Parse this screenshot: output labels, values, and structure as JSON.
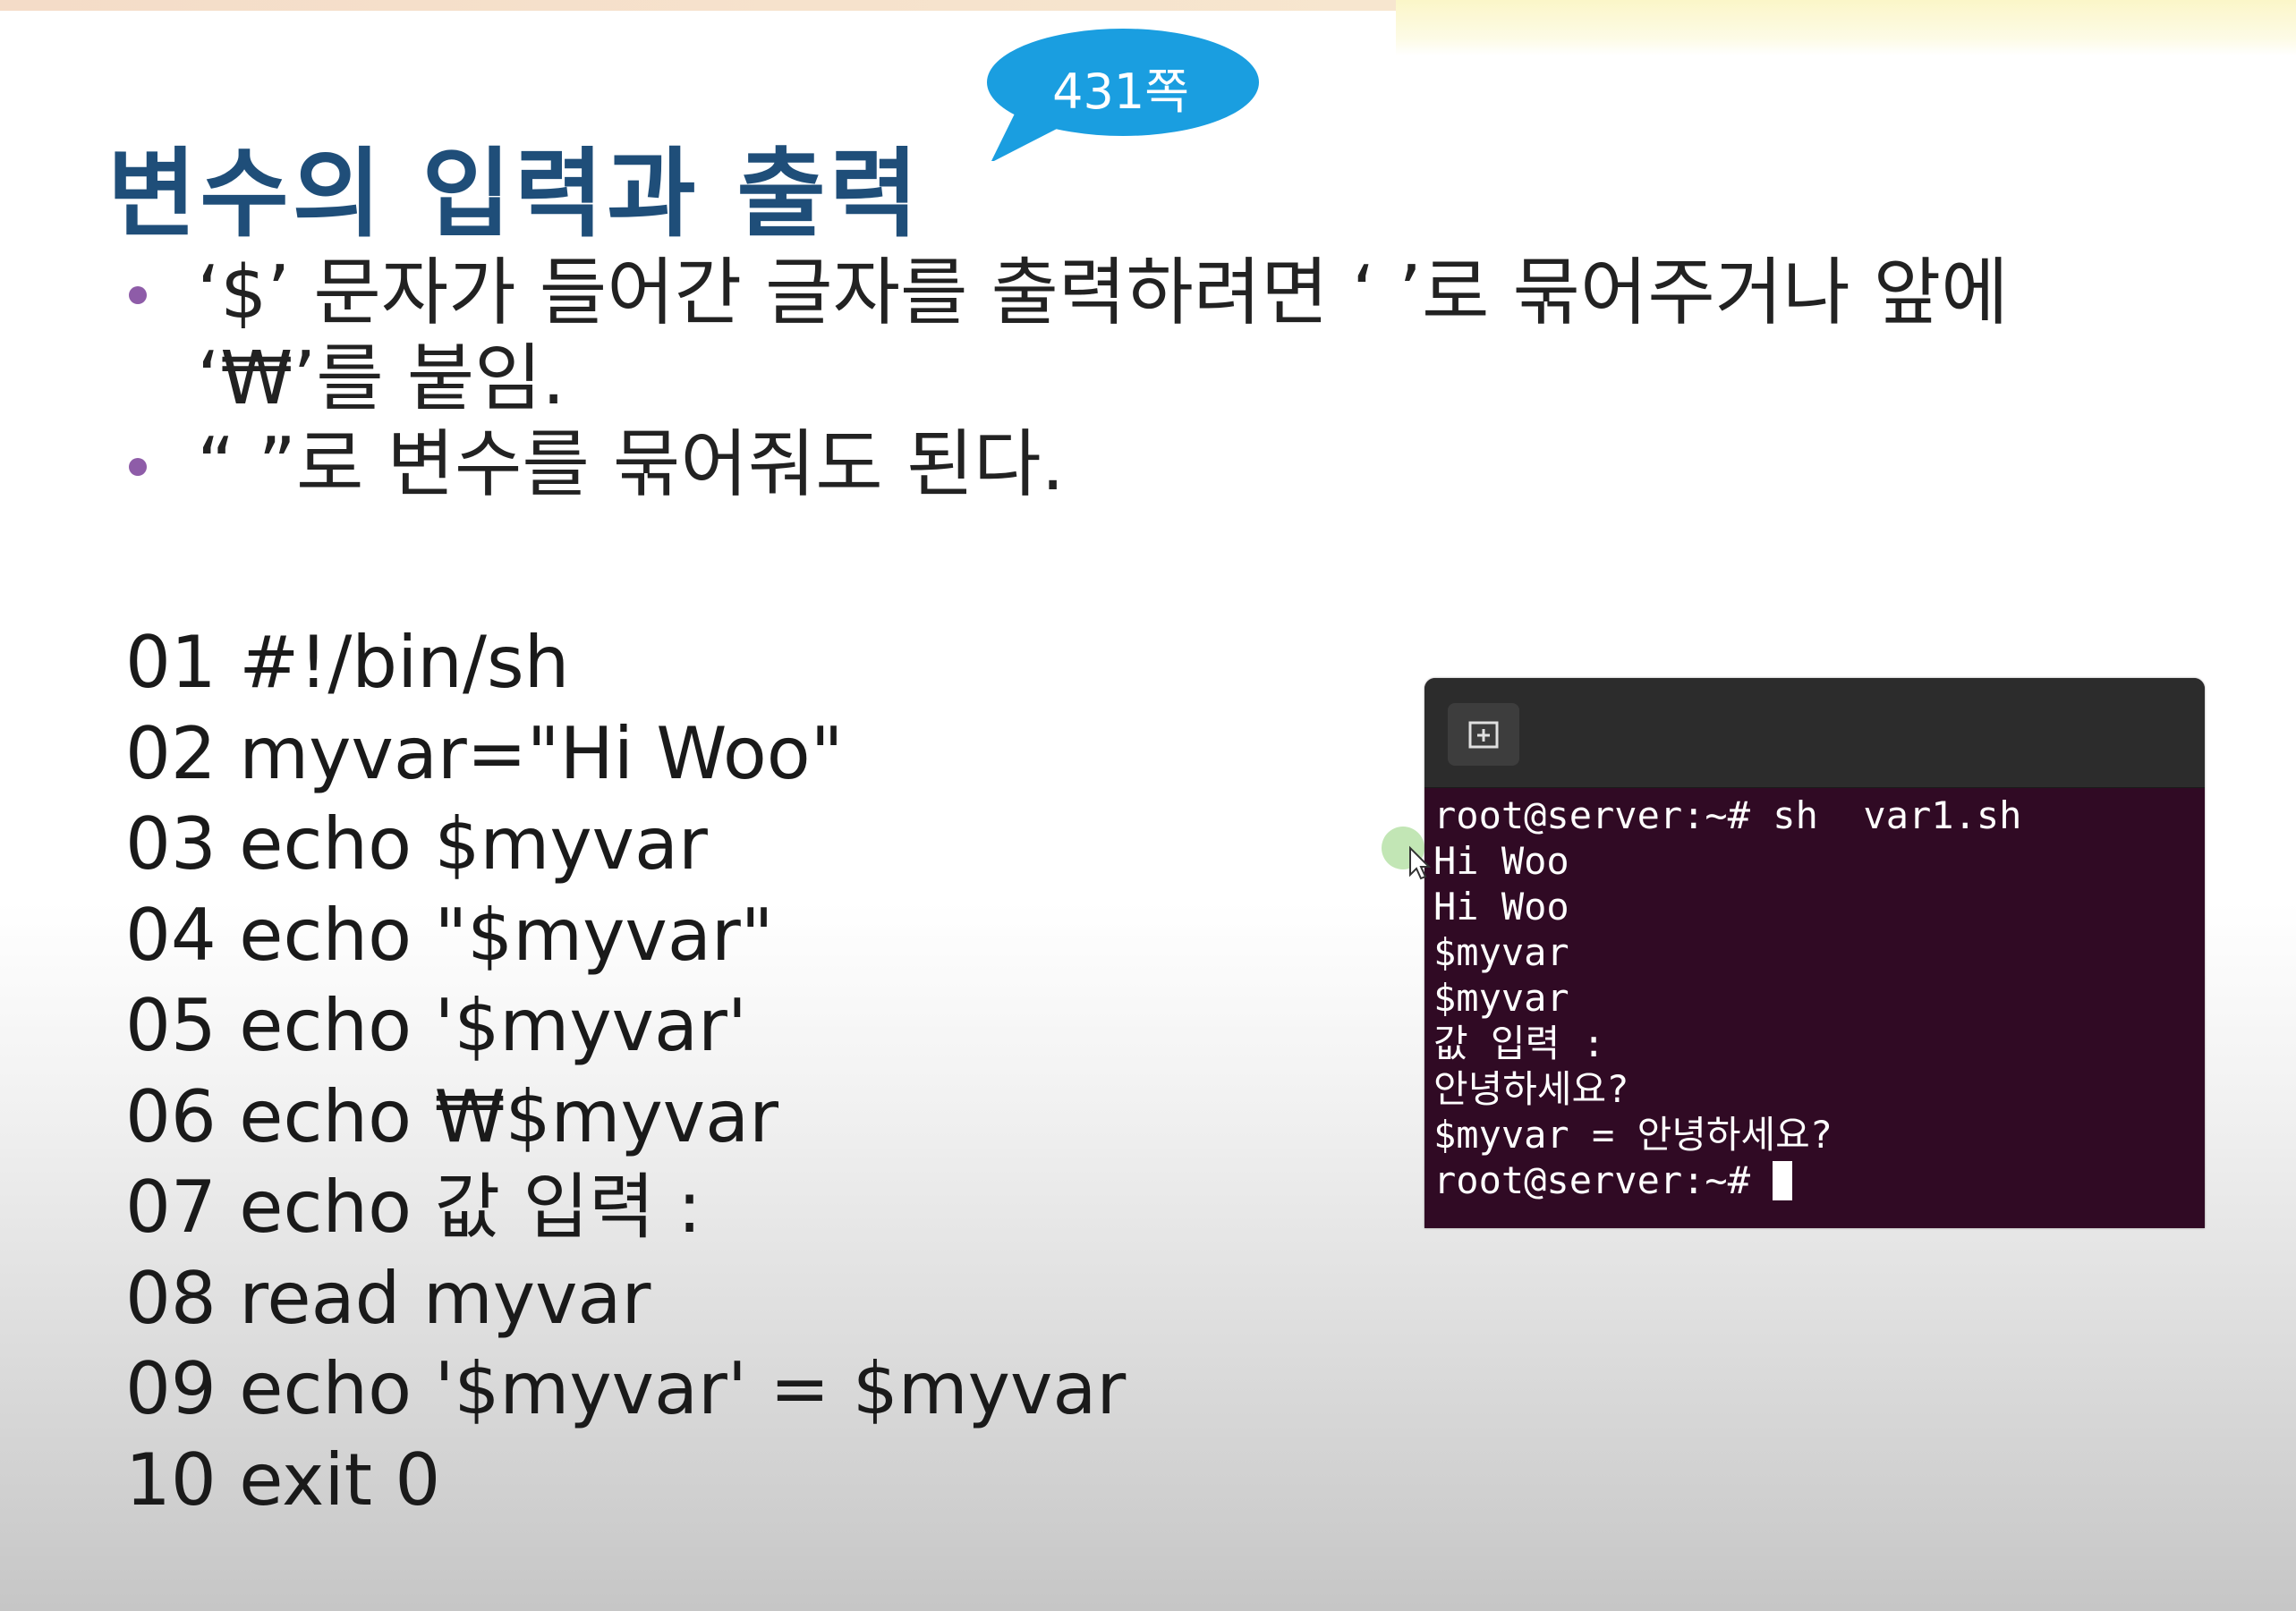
{
  "slide": {
    "title": "변수의 입력과 출력",
    "page_ref": "431쪽",
    "bullets": [
      "‘$’ 문자가 들어간 글자를 출력하려면 ‘ ’로 묶어주거나 앞에 ‘₩’를 붙임.",
      "“ ”로 변수를 묶어줘도 된다."
    ],
    "code_lines": [
      "01 #!/bin/sh",
      "02 myvar=\"Hi Woo\"",
      "03 echo $myvar",
      "04 echo \"$myvar\"",
      "05 echo '$myvar'",
      "06 echo ₩$myvar",
      "07 echo 값 입력 :",
      "08 read myvar",
      "09 echo '$myvar' = $myvar",
      "10 exit 0"
    ]
  },
  "terminal": {
    "new_tab_icon": "new-tab-icon",
    "lines": [
      "root@server:~# sh  var1.sh",
      "Hi Woo",
      "Hi Woo",
      "$myvar",
      "$myvar",
      "값 입력 :",
      "안녕하세요?",
      "$myvar = 안녕하세요?",
      "root@server:~# "
    ]
  },
  "colors": {
    "title": "#1f4e79",
    "bubble": "#1a9ee0",
    "bullet_dot": "#8e5ca8",
    "terminal_bg": "#300a24",
    "terminal_header": "#2c2c2c"
  }
}
